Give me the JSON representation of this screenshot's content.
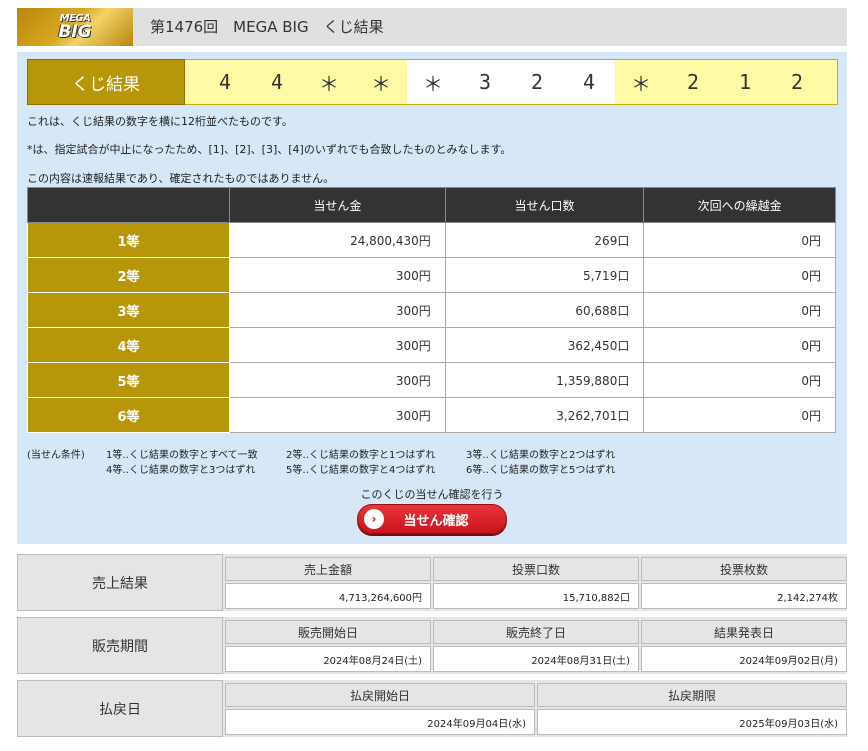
{
  "header": {
    "logo_mega": "MEGA",
    "logo_big": "BIG",
    "title": "第1476回　MEGA BIG　くじ結果"
  },
  "result": {
    "label": "くじ結果",
    "digits": [
      "4",
      "4",
      "＊",
      "＊",
      "＊",
      "3",
      "2",
      "4",
      "＊",
      "2",
      "1",
      "2"
    ]
  },
  "notes": [
    "これは、くじ結果の数字を横に12桁並べたものです。",
    "*は、指定試合が中止になったため、[1]、[2]、[3]、[4]のいずれでも合致したものとみなします。",
    "この内容は速報結果であり、確定されたものではありません。"
  ],
  "prize_table": {
    "headers": [
      "当せん金",
      "当せん口数",
      "次回への繰越金"
    ],
    "rows": [
      {
        "grade": "1等",
        "amount": "24,800,430円",
        "count": "269口",
        "carry": "0円"
      },
      {
        "grade": "2等",
        "amount": "300円",
        "count": "5,719口",
        "carry": "0円"
      },
      {
        "grade": "3等",
        "amount": "300円",
        "count": "60,688口",
        "carry": "0円"
      },
      {
        "grade": "4等",
        "amount": "300円",
        "count": "362,450口",
        "carry": "0円"
      },
      {
        "grade": "5等",
        "amount": "300円",
        "count": "1,359,880口",
        "carry": "0円"
      },
      {
        "grade": "6等",
        "amount": "300円",
        "count": "3,262,701口",
        "carry": "0円"
      }
    ]
  },
  "conditions": {
    "label": "(当せん条件)",
    "items": [
      "1等‥くじ結果の数字とすべて一致",
      "2等‥くじ結果の数字と1つはずれ",
      "3等‥くじ結果の数字と2つはずれ",
      "4等‥くじ結果の数字と3つはずれ",
      "5等‥くじ結果の数字と4つはずれ",
      "6等‥くじ結果の数字と5つはずれ"
    ]
  },
  "check": {
    "text": "このくじの当せん確認を行う",
    "button_label": "当せん確認"
  },
  "sales": {
    "title": "売上結果",
    "columns": [
      {
        "header": "売上金額",
        "value": "4,713,264,600円"
      },
      {
        "header": "投票口数",
        "value": "15,710,882口"
      },
      {
        "header": "投票枚数",
        "value": "2,142,274枚"
      }
    ]
  },
  "period": {
    "title": "販売期間",
    "columns": [
      {
        "header": "販売開始日",
        "value": "2024年08月24日(土)"
      },
      {
        "header": "販売終了日",
        "value": "2024年08月31日(土)"
      },
      {
        "header": "結果発表日",
        "value": "2024年09月02日(月)"
      }
    ]
  },
  "payout": {
    "title": "払戻日",
    "columns": [
      {
        "header": "払戻開始日",
        "value": "2024年09月04日(水)"
      },
      {
        "header": "払戻期限",
        "value": "2025年09月03日(水)"
      }
    ]
  },
  "colors": {
    "gold": "#b8960a",
    "panel_bg": "#d6e8f7",
    "digit_yellow": "#fffaa6",
    "header_dark": "#333333",
    "button_red": "#c8141b"
  }
}
